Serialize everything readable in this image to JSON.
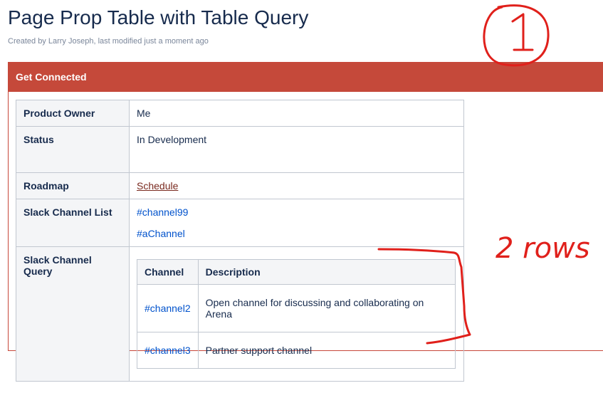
{
  "page": {
    "title": "Page Prop Table with Table Query",
    "byline": "Created by Larry Joseph, last modified just a moment ago"
  },
  "panel": {
    "header": "Get Connected",
    "header_color": "#c5493a"
  },
  "properties": {
    "product_owner": {
      "label": "Product Owner",
      "value": "Me"
    },
    "status": {
      "label": "Status",
      "value": "In Development"
    },
    "roadmap": {
      "label": "Roadmap",
      "link": "Schedule"
    },
    "slack_channel_list": {
      "label": "Slack Channel List",
      "channels": [
        "#channel99",
        "#aChannel"
      ]
    },
    "slack_channel_query": {
      "label": "Slack Channel Query",
      "columns": [
        "Channel",
        "Description"
      ],
      "rows": [
        {
          "channel": "#channel2",
          "description": "Open channel for discussing and collaborating on Arena"
        },
        {
          "channel": "#channel3",
          "description": "Partner support channel"
        }
      ]
    }
  },
  "annotations": {
    "circle_label": "1",
    "rows_note": "2 rows",
    "ink_color": "#e0201b"
  }
}
